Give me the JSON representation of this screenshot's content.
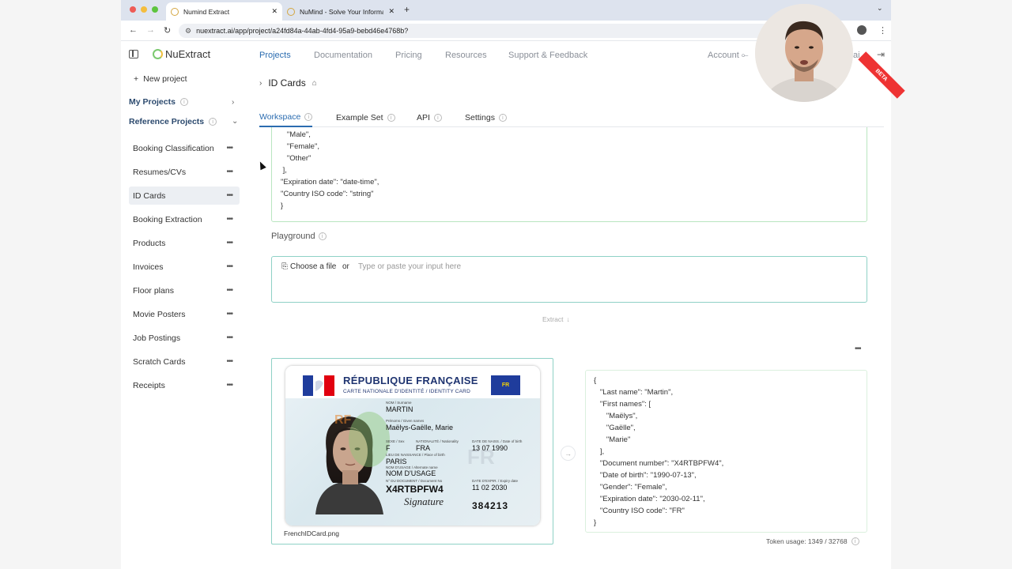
{
  "browser": {
    "tabs": [
      {
        "title": "Numind Extract",
        "active": true
      },
      {
        "title": "NuMind - Solve Your Informati",
        "active": false
      }
    ],
    "url": "nuextract.ai/app/project/a24fd84a-44ab-4fd4-95a9-bebd46e4768b?"
  },
  "header": {
    "logo": "NuExtract",
    "nav": [
      "Projects",
      "Documentation",
      "Pricing",
      "Resources",
      "Support & Feedback"
    ],
    "account": "Account",
    "account_tail": "ai"
  },
  "sidebar": {
    "new_project": "New project",
    "my_projects": "My Projects",
    "reference_projects": "Reference Projects",
    "items": [
      "Booking Classification",
      "Resumes/CVs",
      "ID Cards",
      "Booking Extraction",
      "Products",
      "Invoices",
      "Floor plans",
      "Movie Posters",
      "Job Postings",
      "Scratch Cards",
      "Receipts"
    ],
    "selected": "ID Cards"
  },
  "project": {
    "title": "ID Cards",
    "tabs": [
      "Workspace",
      "Example Set",
      "API",
      "Settings"
    ],
    "active_tab": "Workspace"
  },
  "schema_code": "\"Gender\": [\n   \"Male\",\n   \"Female\",\n   \"Other\"\n ],\n\"Expiration date\": \"date-time\",\n\"Country ISO code\": \"string\"\n}",
  "playground": {
    "label": "Playground",
    "choose_file": "Choose a file",
    "or": "or",
    "placeholder": "Type or paste your input here",
    "extract_label": "Extract",
    "file_name": "FrenchIDCard.png",
    "token_usage": "Token usage: 1349 / 32768"
  },
  "output_code": "{\n   \"Last name\": \"Martin\",\n   \"First names\": [\n      \"Maëlys\",\n      \"Gaëlle\",\n      \"Marie\"\n   ],\n   \"Document number\": \"X4RTBPFW4\",\n   \"Date of birth\": \"1990-07-13\",\n   \"Gender\": \"Female\",\n   \"Expiration date\": \"2030-02-11\",\n   \"Country ISO code\": \"FR\"\n}",
  "id_card": {
    "title": "RÉPUBLIQUE FRANÇAISE",
    "subtitle": "CARTE NATIONALE D'IDENTITÉ / IDENTITY CARD",
    "eu_code": "FR",
    "label_surname": "NOM / Surname",
    "surname": "MARTIN",
    "label_given": "Prénoms / Given names",
    "given": "Maëlys-Gaëlle, Marie",
    "label_sex": "SEXE / Sex",
    "sex": "F",
    "label_nat": "NATIONALITÉ / Nationality",
    "nat": "FRA",
    "label_dob": "DATE DE NAISS. / Date of birth",
    "dob": "13 07 1990",
    "label_pob": "LIEU DE NAISSANCE / Place of birth",
    "pob": "PARIS",
    "label_usage": "NOM D'USAGE / Alternate name",
    "usage": "NOM D'USAGE",
    "label_docno": "N° DU DOCUMENT / Document No",
    "docno": "X4RTBPFW4",
    "label_exp": "DATE D'EXPIR. / Expiry date",
    "exp": "11 02 2030",
    "can": "384213",
    "signature": "Signature",
    "rf": "RF",
    "watermark": "FR"
  },
  "overlay": {
    "beta": "BETA"
  },
  "colors": {
    "accent": "#2b6cb0",
    "teal_border": "#8fd1c6",
    "green_border": "#b9e6c0"
  }
}
